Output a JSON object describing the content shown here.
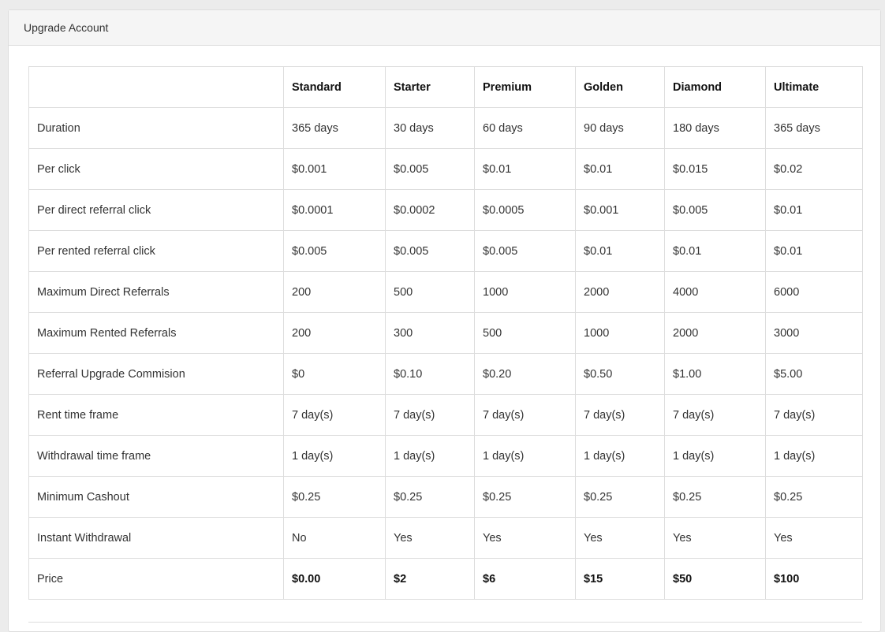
{
  "panel": {
    "title": "Upgrade Account"
  },
  "plans": [
    "Standard",
    "Starter",
    "Premium",
    "Golden",
    "Diamond",
    "Ultimate"
  ],
  "rows": [
    {
      "label": "Duration",
      "values": [
        "365 days",
        "30 days",
        "60 days",
        "90 days",
        "180 days",
        "365 days"
      ]
    },
    {
      "label": "Per click",
      "values": [
        "$0.001",
        "$0.005",
        "$0.01",
        "$0.01",
        "$0.015",
        "$0.02"
      ]
    },
    {
      "label": "Per direct referral click",
      "values": [
        "$0.0001",
        "$0.0002",
        "$0.0005",
        "$0.001",
        "$0.005",
        "$0.01"
      ]
    },
    {
      "label": "Per rented referral click",
      "values": [
        "$0.005",
        "$0.005",
        "$0.005",
        "$0.01",
        "$0.01",
        "$0.01"
      ]
    },
    {
      "label": "Maximum Direct Referrals",
      "values": [
        "200",
        "500",
        "1000",
        "2000",
        "4000",
        "6000"
      ]
    },
    {
      "label": "Maximum Rented Referrals",
      "values": [
        "200",
        "300",
        "500",
        "1000",
        "2000",
        "3000"
      ]
    },
    {
      "label": "Referral Upgrade Commision",
      "values": [
        "$0",
        "$0.10",
        "$0.20",
        "$0.50",
        "$1.00",
        "$5.00"
      ]
    },
    {
      "label": "Rent time frame",
      "values": [
        "7 day(s)",
        "7 day(s)",
        "7 day(s)",
        "7 day(s)",
        "7 day(s)",
        "7 day(s)"
      ]
    },
    {
      "label": "Withdrawal time frame",
      "values": [
        "1 day(s)",
        "1 day(s)",
        "1 day(s)",
        "1 day(s)",
        "1 day(s)",
        "1 day(s)"
      ]
    },
    {
      "label": "Minimum Cashout",
      "values": [
        "$0.25",
        "$0.25",
        "$0.25",
        "$0.25",
        "$0.25",
        "$0.25"
      ]
    },
    {
      "label": "Instant Withdrawal",
      "values": [
        "No",
        "Yes",
        "Yes",
        "Yes",
        "Yes",
        "Yes"
      ]
    },
    {
      "label": "Price",
      "values": [
        "$0.00",
        "$2",
        "$6",
        "$15",
        "$50",
        "$100"
      ]
    }
  ]
}
